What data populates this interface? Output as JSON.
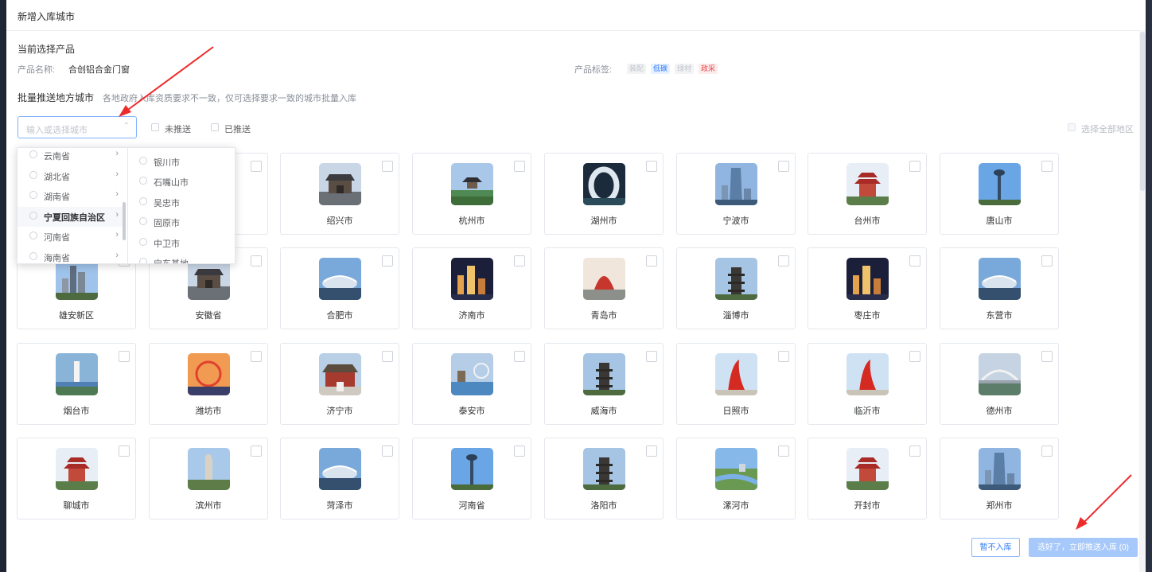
{
  "dialog": {
    "title": "新增入库城市"
  },
  "current_product": {
    "section_title": "当前选择产品",
    "name_label": "产品名称:",
    "name_value": "合创铝合金门窗",
    "tags_label": "产品标签:",
    "tags": [
      {
        "text": "装配",
        "style": "gray"
      },
      {
        "text": "低碳",
        "style": "blue"
      },
      {
        "text": "绿材",
        "style": "gray"
      },
      {
        "text": "政采",
        "style": "red"
      }
    ]
  },
  "batch": {
    "title": "批量推送地方城市",
    "description": "各地政府入库资质要求不一致，仅可选择要求一致的城市批量入库"
  },
  "filters": {
    "city_select_placeholder": "输入或选择城市",
    "not_pushed_label": "未推送",
    "pushed_label": "已推送",
    "select_all_label": "选择全部地区"
  },
  "cascader": {
    "provinces": [
      {
        "label": "云南省",
        "active": false
      },
      {
        "label": "湖北省",
        "active": false
      },
      {
        "label": "湖南省",
        "active": false
      },
      {
        "label": "宁夏回族自治区",
        "active": true
      },
      {
        "label": "河南省",
        "active": false
      },
      {
        "label": "海南省",
        "active": false
      }
    ],
    "cities": [
      "银川市",
      "石嘴山市",
      "吴忠市",
      "固原市",
      "中卫市",
      "宁东基地"
    ]
  },
  "cities": [
    {
      "name": "",
      "scene": "tower"
    },
    {
      "name": "",
      "scene": "tower"
    },
    {
      "name": "绍兴市",
      "scene": "gate"
    },
    {
      "name": "杭州市",
      "scene": "lake"
    },
    {
      "name": "湖州市",
      "scene": "arc"
    },
    {
      "name": "宁波市",
      "scene": "skyscraper"
    },
    {
      "name": "台州市",
      "scene": "pagoda-red"
    },
    {
      "name": "唐山市",
      "scene": "spire"
    },
    {
      "name": "雄安新区",
      "scene": "tower"
    },
    {
      "name": "安徽省",
      "scene": "gate"
    },
    {
      "name": "合肥市",
      "scene": "stadium"
    },
    {
      "name": "济南市",
      "scene": "night-city"
    },
    {
      "name": "青岛市",
      "scene": "torch"
    },
    {
      "name": "淄博市",
      "scene": "pagoda"
    },
    {
      "name": "枣庄市",
      "scene": "night-city"
    },
    {
      "name": "东营市",
      "scene": "stadium"
    },
    {
      "name": "烟台市",
      "scene": "lighthouse"
    },
    {
      "name": "潍坊市",
      "scene": "wheel"
    },
    {
      "name": "济宁市",
      "scene": "temple"
    },
    {
      "name": "泰安市",
      "scene": "harbor"
    },
    {
      "name": "威海市",
      "scene": "pagoda"
    },
    {
      "name": "日照市",
      "scene": "sculpture"
    },
    {
      "name": "临沂市",
      "scene": "sculpture"
    },
    {
      "name": "德州市",
      "scene": "bridge"
    },
    {
      "name": "聊城市",
      "scene": "pagoda-red"
    },
    {
      "name": "滨州市",
      "scene": "statue"
    },
    {
      "name": "菏泽市",
      "scene": "stadium"
    },
    {
      "name": "河南省",
      "scene": "spire"
    },
    {
      "name": "洛阳市",
      "scene": "pagoda"
    },
    {
      "name": "漯河市",
      "scene": "river"
    },
    {
      "name": "开封市",
      "scene": "pagoda-red"
    },
    {
      "name": "郑州市",
      "scene": "skyscraper"
    }
  ],
  "actions": {
    "later_label": "暂不入库",
    "push_label": "选好了，立即推送入库 (0)"
  }
}
